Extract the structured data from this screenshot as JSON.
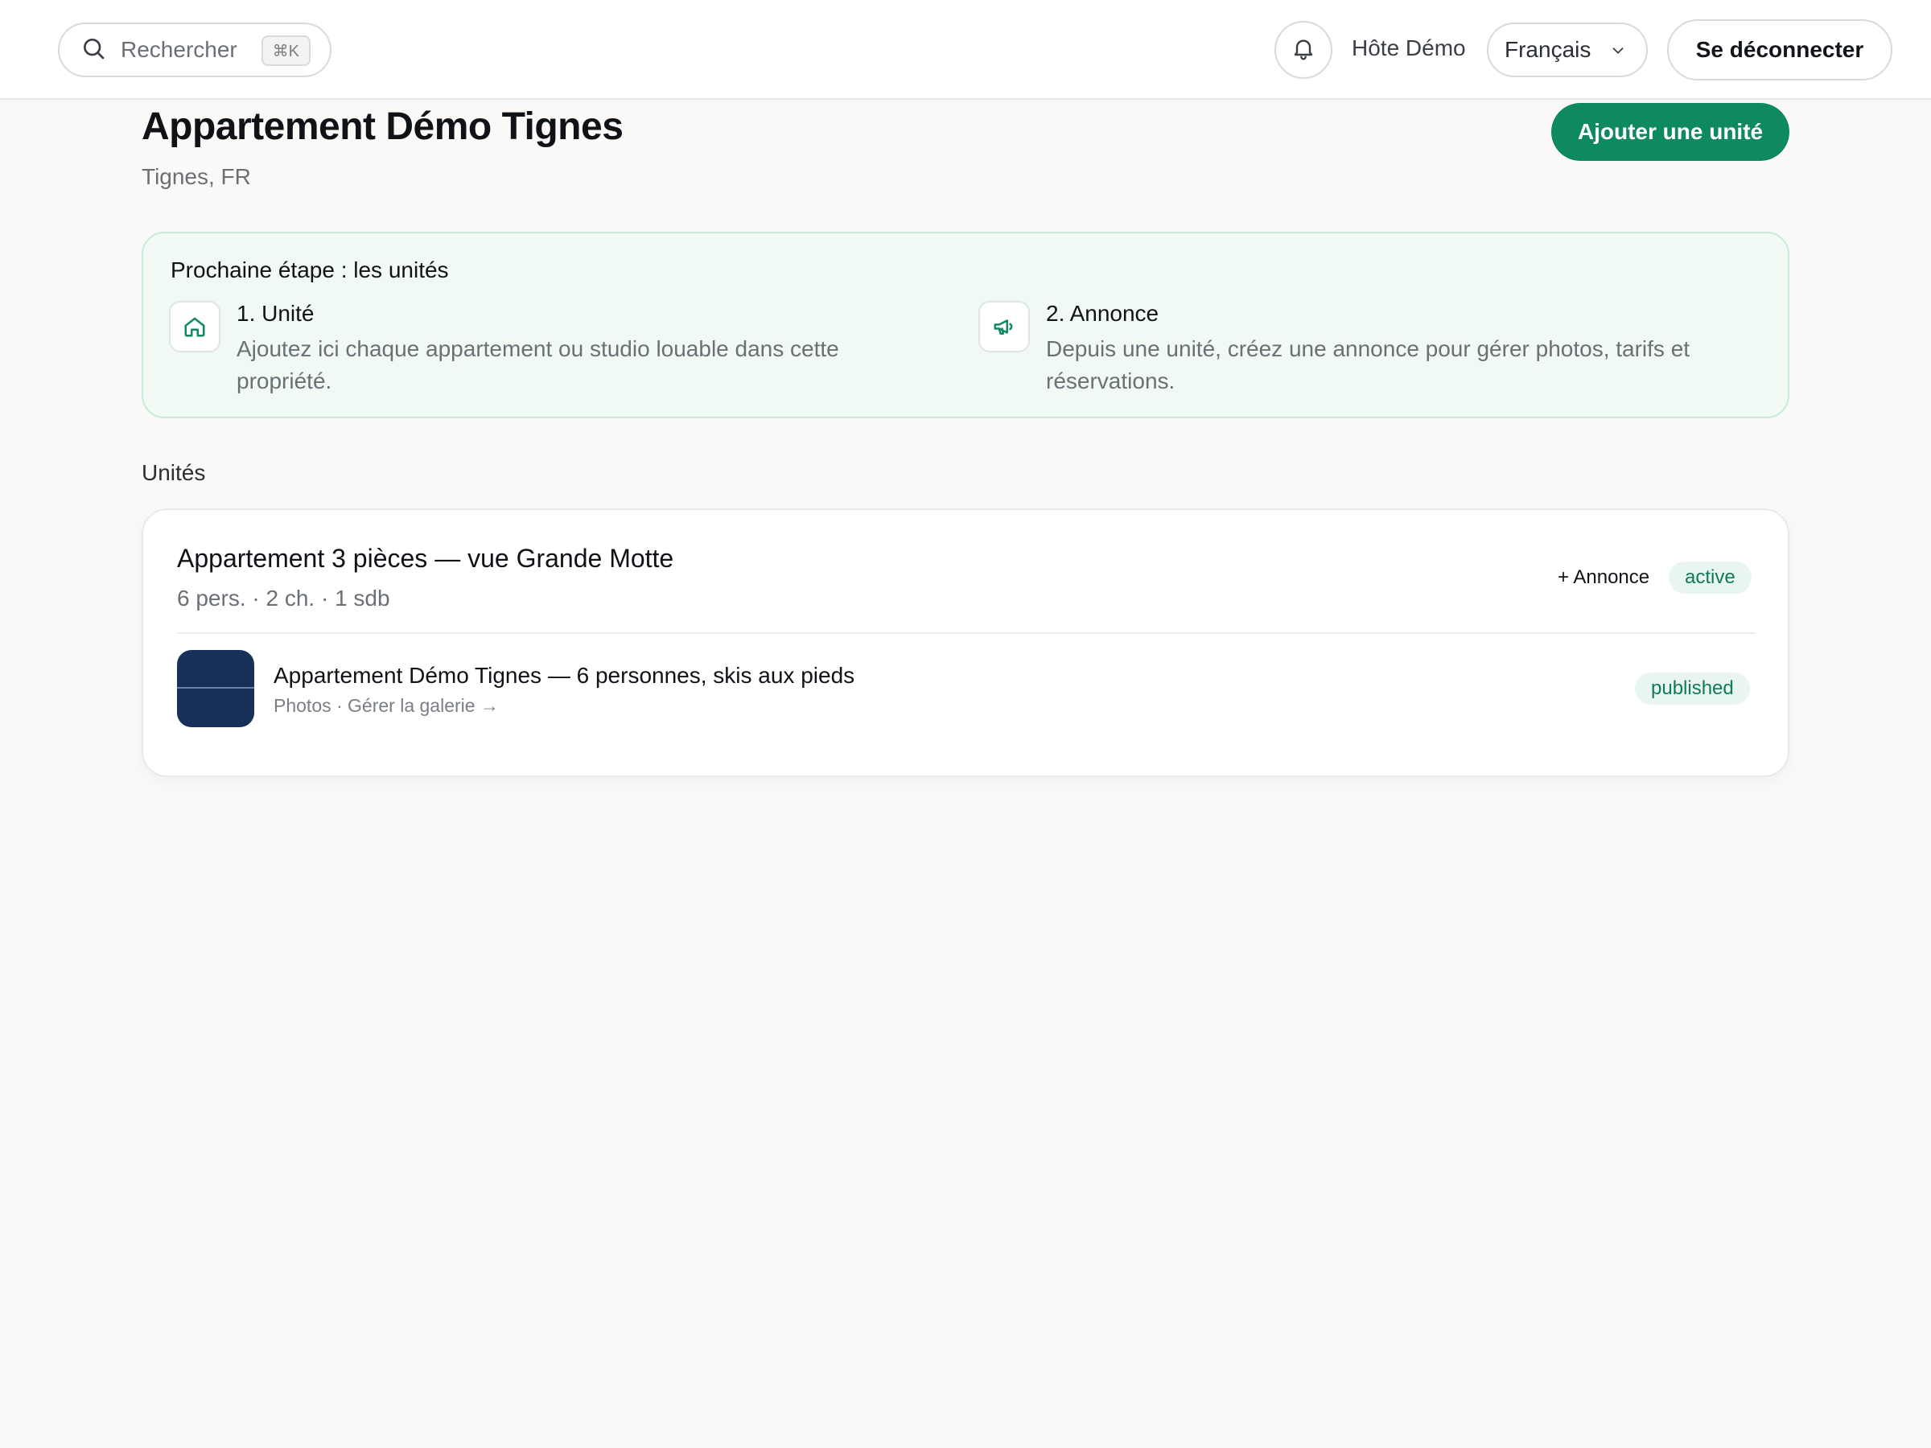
{
  "header": {
    "search_placeholder": "Rechercher",
    "search_shortcut": "⌘K",
    "user_name": "Hôte Démo",
    "language": "Français",
    "logout_label": "Se déconnecter"
  },
  "property": {
    "title": "Appartement Démo Tignes",
    "location": "Tignes, FR",
    "add_unit_label": "Ajouter une unité"
  },
  "next_step": {
    "title": "Prochaine étape : les unités",
    "steps": [
      {
        "title": "1. Unité",
        "description": "Ajoutez ici chaque appartement ou studio louable dans cette propriété.",
        "icon": "home-icon"
      },
      {
        "title": "2. Annonce",
        "description": "Depuis une unité, créez une annonce pour gérer photos, tarifs et réservations.",
        "icon": "megaphone-icon"
      }
    ]
  },
  "units": {
    "section_label": "Unités",
    "items": [
      {
        "title": "Appartement 3 pièces — vue Grande Motte",
        "meta": "6 pers. · 2 ch. · 1 sdb",
        "add_listing_label": "+ Annonce",
        "status": "active",
        "listings": [
          {
            "title": "Appartement Démo Tignes — 6 personnes, skis aux pieds",
            "subtitle": "Photos · Gérer la galerie →",
            "status": "published"
          }
        ]
      }
    ]
  },
  "colors": {
    "accent": "#0f8a5f",
    "badge_bg": "#e8f6ef",
    "badge_text": "#0f7a55",
    "next_step_bg": "#f1f9f5",
    "page_bg": "#faf9f7"
  }
}
